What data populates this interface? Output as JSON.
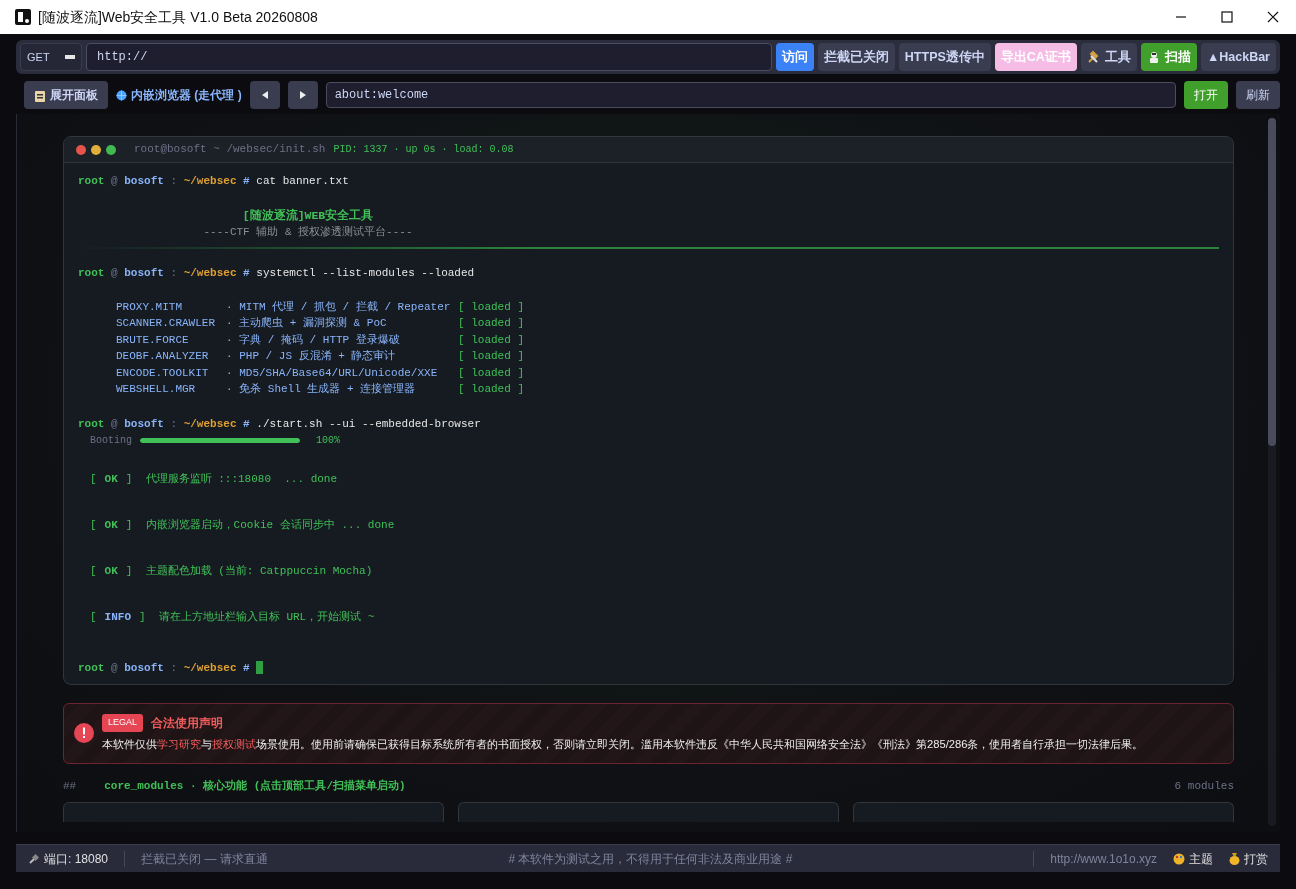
{
  "window": {
    "title": "[随波逐流]Web安全工具 V1.0 Beta 20260808"
  },
  "request_bar": {
    "method": "GET",
    "url": "http://",
    "buttons": [
      {
        "label": "访问",
        "kind": "primary"
      },
      {
        "label": "拦截已关闭",
        "kind": "neutral"
      },
      {
        "label": "HTTPS透传中",
        "kind": "neutral"
      },
      {
        "label": "导出CA证书",
        "kind": "pink"
      },
      {
        "label": "工具",
        "kind": "tools"
      },
      {
        "label": "扫描",
        "kind": "scan"
      },
      {
        "label": "▲HackBar",
        "kind": "neutral"
      }
    ]
  },
  "browser_bar": {
    "expand_button": "展开面板",
    "proxy_label": "内嵌浏览器 (走代理 )",
    "address": "about:welcome",
    "open_button": "打开",
    "refresh_button": "刷新"
  },
  "terminal": {
    "title": "root@bosoft ~ /websec/init.sh",
    "stats": "PID: 1337 · up 0s · load: 0.08",
    "lines": [
      {
        "kind": "prompt",
        "user": "root",
        "at": "@",
        "host": "bosoft",
        "sep": ":",
        "path": "~/websec",
        "symbol": "#",
        "command": "cat banner.txt"
      },
      {
        "kind": "banner",
        "title": "[随波逐流]WEB安全工具",
        "subtitle": "----CTF 辅助 & 授权渗透测试平台----"
      },
      {
        "kind": "prompt",
        "user": "root",
        "at": "@",
        "host": "bosoft",
        "sep": ":",
        "path": "~/websec",
        "symbol": "#",
        "command": "systemctl --list-modules --loaded"
      },
      {
        "kind": "modules",
        "rows": [
          {
            "name": "PROXY.MITM",
            "desc": "· MITM 代理 / 抓包 / 拦截 / Repeater",
            "status": "[ loaded  ]"
          },
          {
            "name": "SCANNER.CRAWLER",
            "desc": "· 主动爬虫 + 漏洞探测 & PoC",
            "status": "[ loaded  ]"
          },
          {
            "name": "BRUTE.FORCE",
            "desc": "· 字典 / 掩码 / HTTP 登录爆破",
            "status": "[ loaded  ]"
          },
          {
            "name": "DEOBF.ANALYZER",
            "desc": "· PHP / JS 反混淆 + 静态审计",
            "status": "[ loaded  ]"
          },
          {
            "name": "ENCODE.TOOLKIT",
            "desc": "· MD5/SHA/Base64/URL/Unicode/XXE",
            "status": "[ loaded  ]"
          },
          {
            "name": "WEBSHELL.MGR",
            "desc": "· 免杀 Shell 生成器 + 连接管理器",
            "status": "[ loaded  ]"
          }
        ]
      },
      {
        "kind": "prompt",
        "user": "root",
        "at": "@",
        "host": "bosoft",
        "sep": ":",
        "path": "~/websec",
        "symbol": "#",
        "command": "./start.sh --ui --embedded-browser"
      },
      {
        "kind": "progress",
        "label": "Booting",
        "level": 1,
        "reading": "100%"
      },
      {
        "kind": "ok",
        "open": "[",
        "tag": "OK",
        "close": "]",
        "text": "代理服务监听 :::18080  ... done"
      },
      {
        "kind": "ok",
        "open": "[",
        "tag": "OK",
        "close": "]",
        "text": "内嵌浏览器启动，Cookie 会话同步中 ... done"
      },
      {
        "kind": "ok",
        "open": "[",
        "tag": "OK",
        "close": "]",
        "text": "主题配色加载 (当前: Catppuccin Mocha)"
      },
      {
        "kind": "info",
        "open": "[",
        "tag": "INFO",
        "close": "]",
        "text": "请在上方地址栏输入目标 URL，开始测试 ~"
      },
      {
        "kind": "prompt",
        "user": "root",
        "at": "@",
        "host": "bosoft",
        "sep": ":",
        "path": "~/websec",
        "symbol": "#",
        "cursor": true
      }
    ]
  },
  "legal": {
    "badge": "LEGAL",
    "title": "合法使用声明",
    "text": "本软件仅供**学习研究**与**授权测试**场景使用。使用前请确保已获得目标系统所有者的书面授权，否则请立即关闭。滥用本软件违反《中华人民共和国网络安全法》《刑法》第285/286条，使用者自行承担一切法律后果。"
  },
  "section": {
    "hash": "##",
    "title": "core_modules · 核心功能 (点击顶部工具/扫描菜单启动)",
    "count": "6 modules"
  },
  "status_bar": {
    "port": "端口: 18080",
    "intercept": "拦截已关闭 — 请求直通",
    "notice": "# 本软件为测试之用，不得用于任何非法及商业用途 #",
    "url": "http://www.1o1o.xyz",
    "theme": "主题",
    "donate": "打赏"
  }
}
